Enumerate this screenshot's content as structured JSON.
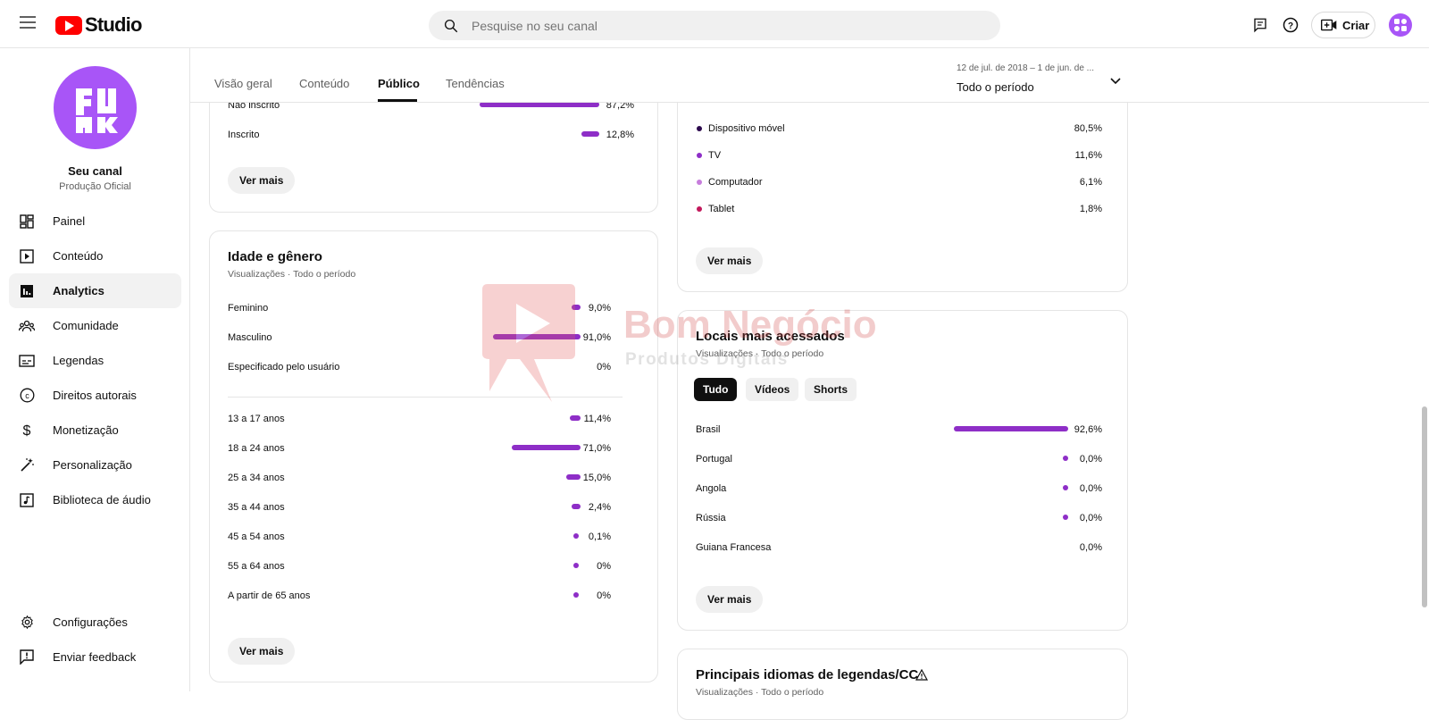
{
  "app": {
    "logo_text": "Studio",
    "search_placeholder": "Pesquise no seu canal",
    "create_label": "Criar"
  },
  "channel": {
    "name": "Seu canal",
    "subtitle": "Produção Oficial"
  },
  "sidebar": {
    "items": [
      {
        "label": "Painel",
        "icon": "dashboard-icon"
      },
      {
        "label": "Conteúdo",
        "icon": "content-icon"
      },
      {
        "label": "Analytics",
        "icon": "analytics-icon",
        "active": true
      },
      {
        "label": "Comunidade",
        "icon": "community-icon"
      },
      {
        "label": "Legendas",
        "icon": "subtitles-icon"
      },
      {
        "label": "Direitos autorais",
        "icon": "copyright-icon"
      },
      {
        "label": "Monetização",
        "icon": "dollar-icon"
      },
      {
        "label": "Personalização",
        "icon": "magic-wand-icon"
      },
      {
        "label": "Biblioteca de áudio",
        "icon": "audio-library-icon"
      }
    ],
    "bottom_items": [
      {
        "label": "Configurações",
        "icon": "gear-icon"
      },
      {
        "label": "Enviar feedback",
        "icon": "feedback-icon"
      }
    ]
  },
  "tabs": [
    {
      "label": "Visão geral"
    },
    {
      "label": "Conteúdo"
    },
    {
      "label": "Público",
      "active": true
    },
    {
      "label": "Tendências"
    }
  ],
  "period": {
    "range": "12 de jul. de 2018 – 1 de jun. de ...",
    "label": "Todo o período"
  },
  "subscription_card": {
    "rows": [
      {
        "label": "Não inscrito",
        "value": "87,2%",
        "fraction": 0.872
      },
      {
        "label": "Inscrito",
        "value": "12,8%",
        "fraction": 0.128
      }
    ],
    "more_label": "Ver mais"
  },
  "age_gender_card": {
    "title": "Idade e gênero",
    "subtitle": "Visualizações · Todo o período",
    "gender_rows": [
      {
        "label": "Feminino",
        "value": "9,0%",
        "fraction": 0.09
      },
      {
        "label": "Masculino",
        "value": "91,0%",
        "fraction": 0.91
      },
      {
        "label": "Especificado pelo usuário",
        "value": "0%",
        "fraction": 0
      }
    ],
    "age_rows": [
      {
        "label": "13 a 17 anos",
        "value": "11,4%",
        "fraction": 0.114
      },
      {
        "label": "18 a 24 anos",
        "value": "71,0%",
        "fraction": 0.71
      },
      {
        "label": "25 a 34 anos",
        "value": "15,0%",
        "fraction": 0.15
      },
      {
        "label": "35 a 44 anos",
        "value": "2,4%",
        "fraction": 0.024
      },
      {
        "label": "45 a 54 anos",
        "value": "0,1%",
        "fraction": 0.001
      },
      {
        "label": "55 a 64 anos",
        "value": "0%",
        "fraction": 0
      },
      {
        "label": "A partir de 65 anos",
        "value": "0%",
        "fraction": 0
      }
    ],
    "more_label": "Ver mais"
  },
  "device_card": {
    "rows": [
      {
        "label": "Dispositivo móvel",
        "value": "80,5%",
        "color": "#2d0a4e"
      },
      {
        "label": "TV",
        "value": "11,6%",
        "color": "#8e2ec7"
      },
      {
        "label": "Computador",
        "value": "6,1%",
        "color": "#c77ddc"
      },
      {
        "label": "Tablet",
        "value": "1,8%",
        "color": "#c2185b"
      }
    ],
    "more_label": "Ver mais"
  },
  "locations_card": {
    "title": "Locais mais acessados",
    "subtitle": "Visualizações · Todo o período",
    "chips": [
      {
        "label": "Tudo",
        "active": true
      },
      {
        "label": "Vídeos"
      },
      {
        "label": "Shorts"
      }
    ],
    "rows": [
      {
        "label": "Brasil",
        "value": "92,6%",
        "fraction": 0.926
      },
      {
        "label": "Portugal",
        "value": "0,0%",
        "fraction": 0.0
      },
      {
        "label": "Angola",
        "value": "0,0%",
        "fraction": 0.0
      },
      {
        "label": "Rússia",
        "value": "0,0%",
        "fraction": 0.0
      },
      {
        "label": "Guiana Francesa",
        "value": "0,0%",
        "fraction": 0.0
      }
    ],
    "more_label": "Ver mais"
  },
  "languages_card": {
    "title": "Principais idiomas de legendas/CC",
    "subtitle": "Visualizações · Todo o período"
  },
  "watermark": {
    "brand": "Bom Negócio",
    "tagline": "Produtos Digitais"
  },
  "colors": {
    "accent": "#8e2ec7",
    "brand_red": "#ff0000",
    "avatar": "#a855f7"
  }
}
